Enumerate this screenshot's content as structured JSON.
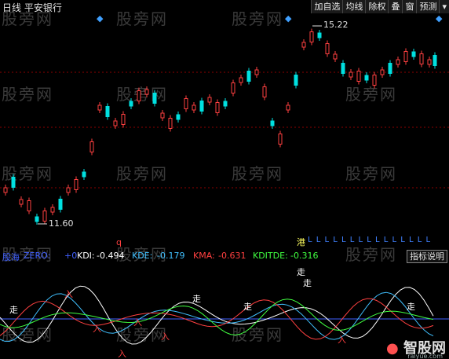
{
  "header": {
    "period": "日线",
    "stock_name": "平安银行"
  },
  "toolbar": {
    "items": [
      "加自选",
      "均线",
      "除权",
      "叠",
      "窗",
      "预测"
    ],
    "close_glyph": "▾"
  },
  "price_chart": {
    "high_label": "15.22",
    "low_label": "11.60",
    "markers": {
      "gang": "港",
      "q": "q",
      "l_marks": "L L L L L L L L L L L L L L L"
    },
    "colors": {
      "up": "#ff4040",
      "down": "#00e0e0",
      "grid": "#8b0000"
    }
  },
  "indicator_bar": {
    "name": "股海",
    "zero_label": "ZERO:",
    "zero_value": "+0",
    "kdi_label": "KDI:",
    "kdi_value": "-0.494",
    "kde_label": "KDE:",
    "kde_value": "-0.179",
    "kma_label": "KMA:",
    "kma_value": "-0.631",
    "kditde_label": "KDITDE:",
    "kditde_value": "-0.316",
    "help_button": "指标说明",
    "colors": {
      "zero": "#4060ff",
      "kdi": "#ffffff",
      "kde": "#40c0ff",
      "kma": "#ff4040",
      "kditde": "#40ff40"
    }
  },
  "indicator_chart": {
    "labels": {
      "walk": "走",
      "enter": "入"
    }
  },
  "watermark": "股旁网",
  "brand": {
    "name": "智股网",
    "url": "raiyue.com"
  }
}
